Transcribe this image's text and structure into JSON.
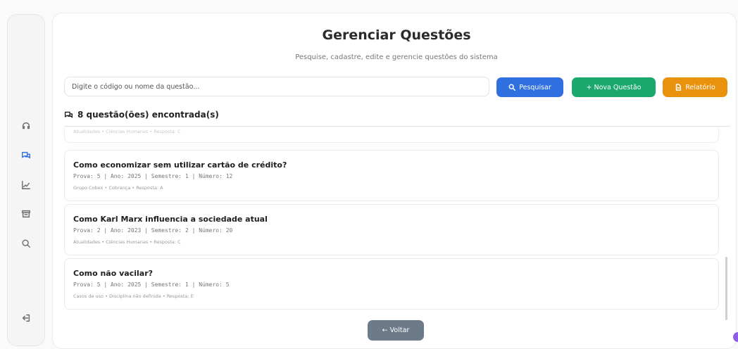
{
  "sidebar": {
    "items": [
      {
        "name": "headset-icon",
        "active": false
      },
      {
        "name": "chat-icon",
        "active": true
      },
      {
        "name": "chart-icon",
        "active": false
      },
      {
        "name": "archive-icon",
        "active": false
      },
      {
        "name": "search-icon",
        "active": false
      }
    ],
    "logout": "logout-icon"
  },
  "header": {
    "title": "Gerenciar Questões",
    "subtitle": "Pesquise, cadastre, edite e gerencie questões do sistema"
  },
  "search": {
    "placeholder": "Digite o código ou nome da questão..."
  },
  "actions": {
    "search_label": "Pesquisar",
    "new_label": "+ Nova Questão",
    "report_label": "Relatório"
  },
  "results": {
    "count_text": "8 questão(ões) encontrada(s)"
  },
  "questions": [
    {
      "title": "Como economizar sem utilizar cartão de crédito?",
      "meta": "Prova: 5 | Ano: 2025 | Semestre: 1 | Número: 12",
      "tags": "Grupo Cobex • Cobrança • Resposta: A"
    },
    {
      "title": "Como Karl Marx influencia a sociedade atual",
      "meta": "Prova: 2 | Ano: 2023 | Semestre: 2 | Número: 20",
      "tags": "Atualidades • Ciências Humanas • Resposta: C"
    },
    {
      "title": "Como não vacilar?",
      "meta": "Prova: 5 | Ano: 2025 | Semestre: 1 | Número: 5",
      "tags": "Casos de uso • Disciplina não definida • Resposta: E"
    }
  ],
  "partial_row": {
    "tags": "Atualidades • Ciências Humanas • Resposta: C"
  },
  "back_label": "← Voltar",
  "colors": {
    "primary": "#2f6fe0",
    "success": "#1aa86e",
    "warning": "#e8920e",
    "back": "#6c7a89"
  }
}
